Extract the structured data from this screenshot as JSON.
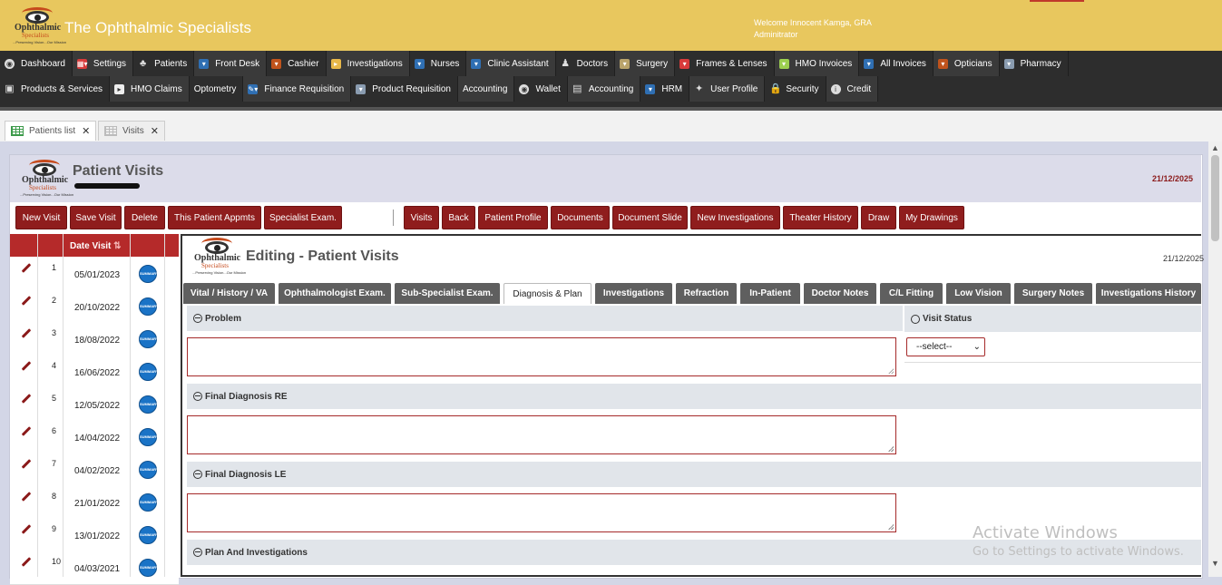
{
  "app": {
    "title": "The Ophthalmic Specialists",
    "welcome_line1": "Welcome Innocent Kamga, GRA",
    "welcome_line2": "Adminitrator"
  },
  "logo": {
    "line1": "Ophthalmic",
    "line2": "Specialists",
    "tagline": "...Preserving Vision...Our Mission",
    "small_the": "The"
  },
  "nav": {
    "row1": [
      {
        "label": "Dashboard",
        "icon": "dashboard-icon"
      },
      {
        "label": "Settings",
        "icon": "settings-icon"
      },
      {
        "label": "Patients",
        "icon": "patients-icon"
      },
      {
        "label": "Front Desk",
        "icon": "dropdown-icon"
      },
      {
        "label": "Cashier",
        "icon": "dropdown-icon"
      },
      {
        "label": "Investigations",
        "icon": "arrow-icon"
      },
      {
        "label": "Nurses",
        "icon": "dropdown-icon"
      },
      {
        "label": "Clinic Assistant",
        "icon": "dropdown-icon"
      },
      {
        "label": "Doctors",
        "icon": "doctor-icon"
      },
      {
        "label": "Surgery",
        "icon": "dropdown-icon"
      },
      {
        "label": "Frames & Lenses",
        "icon": "dropdown-icon"
      },
      {
        "label": "HMO Invoices",
        "icon": "dropdown-icon"
      },
      {
        "label": "All Invoices",
        "icon": "dropdown-icon"
      },
      {
        "label": "Opticians",
        "icon": "dropdown-icon"
      },
      {
        "label": "Pharmacy",
        "icon": "dropdown-icon"
      }
    ],
    "row2": [
      {
        "label": "Products & Services",
        "icon": "products-icon"
      },
      {
        "label": "HMO Claims",
        "icon": "arrow-icon"
      },
      {
        "label": "Optometry",
        "icon": ""
      },
      {
        "label": "Finance Requisition",
        "icon": "finance-icon"
      },
      {
        "label": "Product Requisition",
        "icon": "dropdown-icon"
      },
      {
        "label": "Accounting",
        "icon": ""
      },
      {
        "label": "Wallet",
        "icon": "wallet-icon"
      },
      {
        "label": "Accounting",
        "icon": "accounting-icon"
      },
      {
        "label": "HRM",
        "icon": "dropdown-icon"
      },
      {
        "label": "User Profile",
        "icon": "user-profile-icon"
      },
      {
        "label": "Security",
        "icon": "lock-icon"
      },
      {
        "label": "Credit",
        "icon": "credit-icon"
      }
    ]
  },
  "file_tabs": [
    {
      "label": "Patients list"
    },
    {
      "label": "Visits"
    }
  ],
  "patient_visits": {
    "title": "Patient Visits",
    "date": "21/12/2025"
  },
  "actions": [
    "New Visit",
    "Save Visit",
    "Delete",
    "This Patient Appmts",
    "Specialist Exam.",
    "Visits",
    "Back",
    "Patient Profile",
    "Documents",
    "Document Slide",
    "New Investigations",
    "Theater History",
    "Draw",
    "My Drawings"
  ],
  "visits_list": {
    "header": "Date Visit",
    "sort_icon": "sort-icon",
    "summary_badge": "SUMMARY",
    "rows": [
      {
        "n": "1",
        "date": "05/01/2023"
      },
      {
        "n": "2",
        "date": "20/10/2022"
      },
      {
        "n": "3",
        "date": "18/08/2022"
      },
      {
        "n": "4",
        "date": "16/06/2022"
      },
      {
        "n": "5",
        "date": "12/05/2022"
      },
      {
        "n": "6",
        "date": "14/04/2022"
      },
      {
        "n": "7",
        "date": "04/02/2022"
      },
      {
        "n": "8",
        "date": "21/01/2022"
      },
      {
        "n": "9",
        "date": "13/01/2022"
      },
      {
        "n": "10",
        "date": "04/03/2021"
      }
    ]
  },
  "editing": {
    "title": "Editing - Patient Visits",
    "date": "21/12/2025"
  },
  "sub_tabs": [
    "Vital / History / VA",
    "Ophthalmologist Exam.",
    "Sub-Specialist Exam.",
    "Diagnosis & Plan",
    "Investigations",
    "Refraction",
    "In-Patient",
    "Doctor Notes",
    "C/L Fitting",
    "Low Vision",
    "Surgery Notes",
    "Investigations History"
  ],
  "active_sub_tab": "Diagnosis & Plan",
  "sections": {
    "problem": "Problem",
    "final_re": "Final Diagnosis RE",
    "final_le": "Final Diagnosis LE",
    "plan": "Plan And Investigations",
    "visit_status": "Visit Status"
  },
  "visit_status_select": {
    "value": "--select--"
  },
  "watermark": {
    "line1": "Activate Windows",
    "line2": "Go to Settings to activate Windows."
  }
}
